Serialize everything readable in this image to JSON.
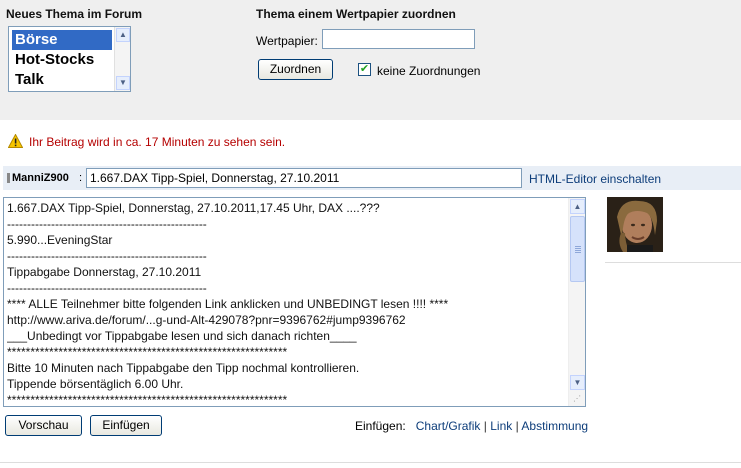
{
  "forum": {
    "title": "Neues Thema im Forum",
    "items": [
      {
        "label": "Börse"
      },
      {
        "label": "Hot-Stocks"
      },
      {
        "label": "Talk"
      }
    ],
    "selected": "Börse"
  },
  "assign": {
    "title": "Thema einem Wertpapier zuordnen",
    "field_label": "Wertpapier:",
    "field_value": "",
    "button_label": "Zuordnen",
    "checkbox_label": "keine Zuordnungen",
    "checkbox_checked": true
  },
  "warning": {
    "text": "Ihr Beitrag wird in ca. 17 Minuten zu sehen sein.",
    "icon": "warning-icon"
  },
  "post": {
    "author": "ManniZ900",
    "subject": "1.667.DAX Tipp-Spiel, Donnerstag, 27.10.2011",
    "html_editor_link": "HTML-Editor einschalten",
    "body_lines": [
      "1.667.DAX Tipp-Spiel, Donnerstag, 27.10.2011,17.45 Uhr, DAX ....???",
      "--------------------------------------------------",
      "5.990...EveningStar",
      "--------------------------------------------------",
      "Tippabgabe Donnerstag, 27.10.2011",
      "--------------------------------------------------",
      "****  ALLE Teilnehmer bitte folgenden Link anklicken und UNBEDINGT lesen !!!! ****",
      "http://www.ariva.de/forum/...g-und-Alt-429078?pnr=9396762#jump9396762",
      "___Unbedingt vor Tippabgabe lesen und sich danach richten____",
      "************************************************************",
      "Bitte 10 Minuten nach Tippabgabe den Tipp nochmal kontrollieren.",
      "Tippende börsentäglich 6.00 Uhr.",
      "************************************************************"
    ]
  },
  "actions": {
    "preview_label": "Vorschau",
    "insert_label": "Einfügen",
    "insert_prefix": "Einfügen:",
    "insert_links": [
      "Chart/Grafik",
      "Link",
      "Abstimmung"
    ],
    "separator": "|"
  },
  "colors": {
    "panel_bg": "#efefef",
    "selection": "#316ac5",
    "warning_text": "#b50000",
    "link": "#0d3d7a",
    "title_bar": "#e8eef6"
  }
}
